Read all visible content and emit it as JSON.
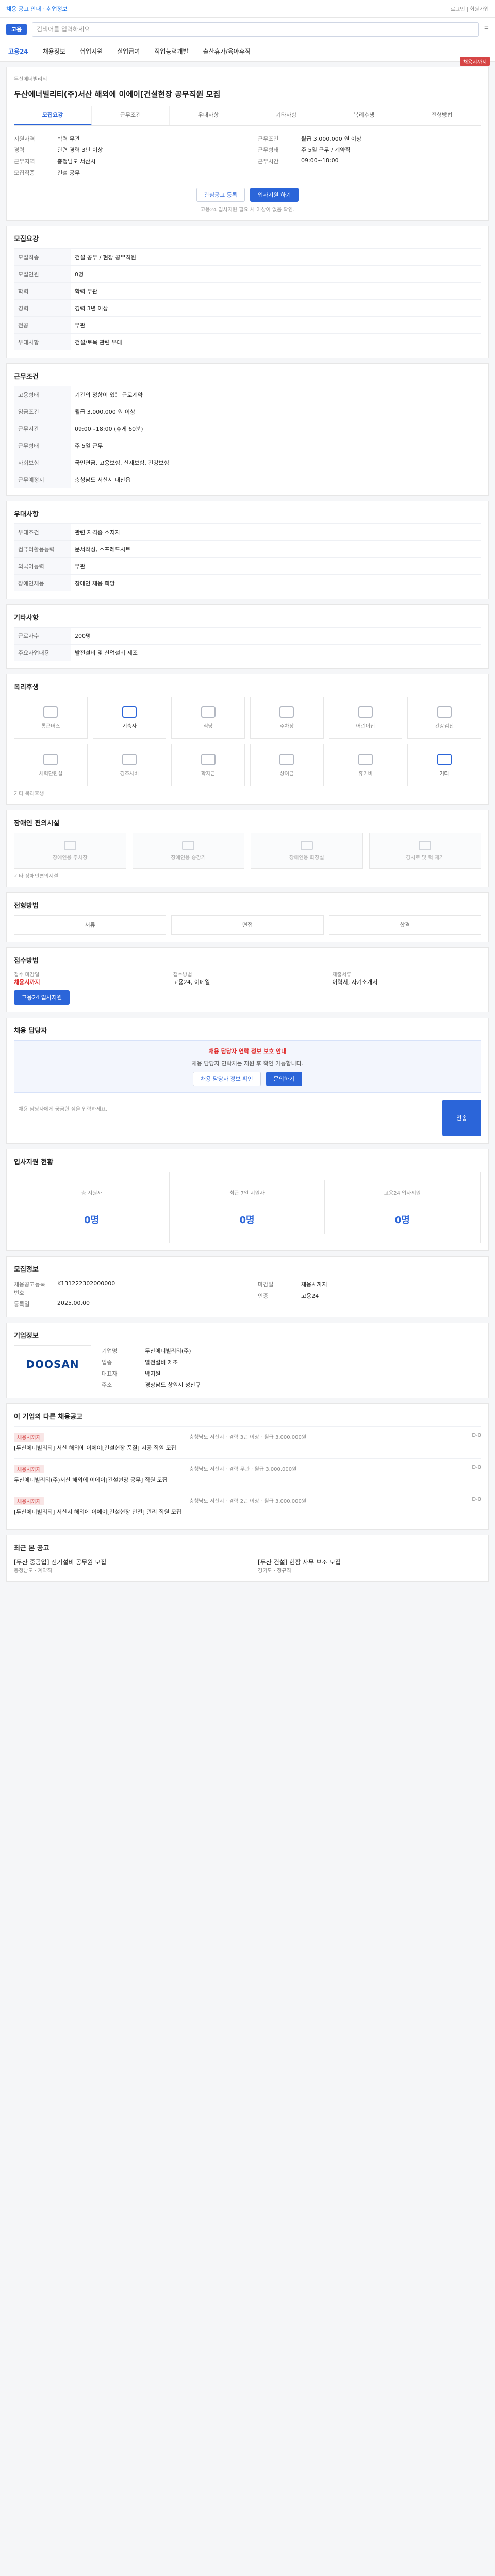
{
  "header": {
    "notice": "채용 공고 안내 · 취업정보",
    "search_placeholder": "검색어를 입력하세요",
    "nav": [
      "고용24",
      "채용정보",
      "취업지원",
      "실업급여",
      "직업능력개발",
      "출산휴가/육아휴직"
    ]
  },
  "job": {
    "company": "두산에너빌리티",
    "title": "두산에너빌리티(주)서산 해외에 이에이[건설현장 공무직원 모집",
    "right_badge": "채용시까지",
    "tabs": [
      "모집요강",
      "근무조건",
      "우대사항",
      "기타사항",
      "복리후생",
      "전형방법"
    ],
    "button_bookmark": "관심공고 등록",
    "button_apply": "입사지원 하기",
    "meta_notice": "고용24 입사지원 필요 시 이상이 없음 확인."
  },
  "summary": {
    "left": [
      {
        "k": "지원자격",
        "v": "학력 무관"
      },
      {
        "k": "경력",
        "v": "관련 경력 3년 이상"
      },
      {
        "k": "근무지역",
        "v": "충청남도 서산시"
      },
      {
        "k": "모집직종",
        "v": "건설 공무"
      }
    ],
    "right": [
      {
        "k": "근무조건",
        "v": "월급 3,000,000 원 이상"
      },
      {
        "k": "근무형태",
        "v": "주 5일 근무 / 계약직"
      },
      {
        "k": "근무시간",
        "v": "09:00~18:00"
      }
    ]
  },
  "recruit_table": [
    {
      "k": "모집직종",
      "v": "건설 공무 / 현장 공무직원"
    },
    {
      "k": "모집인원",
      "v": "0명"
    },
    {
      "k": "학력",
      "v": "학력 무관"
    },
    {
      "k": "경력",
      "v": "경력 3년 이상"
    },
    {
      "k": "전공",
      "v": "무관"
    },
    {
      "k": "우대사항",
      "v": "건설/토목 관련 우대"
    }
  ],
  "work_table": [
    {
      "k": "고용형태",
      "v": "기간의 정함이 있는 근로계약"
    },
    {
      "k": "임금조건",
      "v": "월급 3,000,000 원 이상"
    },
    {
      "k": "근무시간",
      "v": "09:00~18:00 (휴게 60분)"
    },
    {
      "k": "근무형태",
      "v": "주 5일 근무"
    },
    {
      "k": "사회보험",
      "v": "국민연금, 고용보험, 산재보험, 건강보험"
    },
    {
      "k": "근무예정지",
      "v": "충청남도 서산시 대산읍"
    }
  ],
  "pref_table": [
    {
      "k": "우대조건",
      "v": "관련 자격증 소지자"
    },
    {
      "k": "컴퓨터활용능력",
      "v": "문서작성, 스프레드시트"
    },
    {
      "k": "외국어능력",
      "v": "무관"
    },
    {
      "k": "장애인채용",
      "v": "장애인 채용 희망"
    }
  ],
  "other_table": [
    {
      "k": "근로자수",
      "v": "200명"
    },
    {
      "k": "주요사업내용",
      "v": "발전설비 및 산업설비 제조"
    }
  ],
  "welfare": {
    "title": "복리후생",
    "items": [
      {
        "icon": "bus-icon",
        "label": "통근버스",
        "on": false
      },
      {
        "icon": "car-icon",
        "label": "기숙사",
        "on": true
      },
      {
        "icon": "meal-icon",
        "label": "식당",
        "on": false
      },
      {
        "icon": "parking-icon",
        "label": "주차장",
        "on": false
      },
      {
        "icon": "child-icon",
        "label": "어린이집",
        "on": false
      },
      {
        "icon": "health-icon",
        "label": "건강검진",
        "on": false
      },
      {
        "icon": "gym-icon",
        "label": "체력단련실",
        "on": false
      },
      {
        "icon": "gift-icon",
        "label": "경조사비",
        "on": false
      },
      {
        "icon": "school-icon",
        "label": "학자금",
        "on": false
      },
      {
        "icon": "bonus-icon",
        "label": "상여금",
        "on": false
      },
      {
        "icon": "vacation-icon",
        "label": "휴가비",
        "on": false
      },
      {
        "icon": "other-icon",
        "label": "기타",
        "on": true
      }
    ],
    "note": "기타 복리후생"
  },
  "support": {
    "title": "장애인 편의시설",
    "items": [
      "장애인용 주차장",
      "장애인용 승강기",
      "장애인용 화장실",
      "경사로 및 턱 제거"
    ],
    "note": "기타 장애인편의시설"
  },
  "process": {
    "title": "전형방법",
    "steps": [
      "서류",
      "면접",
      "합격"
    ]
  },
  "method": {
    "title": "접수방법",
    "col1_title": "접수 마감일",
    "col1_value": "채용시까지",
    "col1_button": "고용24 입사지원",
    "col2_title": "접수방법",
    "col2_value": "고용24, 이메일",
    "col3_title": "제출서류",
    "col3_value": "이력서, 자기소개서"
  },
  "inquiry": {
    "title": "채용 담당자",
    "alert": "채용 담당자 연락 정보 보호 안내",
    "guide": "채용 담당자 연락처는 지원 후 확인 가능합니다.",
    "button1": "채용 담당자 정보 확인",
    "button2": "문의하기",
    "placeholder": "채용 담당자에게 궁금한 점을 입력하세요.",
    "send": "전송"
  },
  "stats": {
    "title": "입사지원 현황",
    "items": [
      {
        "label": "총 지원자",
        "value": "0명"
      },
      {
        "label": "최근 7일 지원자",
        "value": "0명"
      },
      {
        "label": "고용24 입사지원",
        "value": "0명"
      }
    ]
  },
  "rec_info": {
    "title": "모집정보",
    "left": [
      {
        "k": "채용공고등록번호",
        "v": "K131222302000000"
      },
      {
        "k": "등록일",
        "v": "2025.00.00"
      }
    ],
    "right": [
      {
        "k": "마감일",
        "v": "채용시까지"
      },
      {
        "k": "인증",
        "v": "고용24"
      }
    ]
  },
  "company": {
    "title": "기업정보",
    "logo_text": "DOOSAN",
    "fields": [
      {
        "k": "기업명",
        "v": "두산에너빌리티(주)"
      },
      {
        "k": "업종",
        "v": "발전설비 제조"
      },
      {
        "k": "대표자",
        "v": "박지원"
      },
      {
        "k": "주소",
        "v": "경상남도 창원시 성산구"
      }
    ]
  },
  "related": {
    "title": "이 기업의 다른 채용공고",
    "items": [
      {
        "badge": "채용시까지",
        "title": "[두산에너빌리티] 서산 해외에 이에이[건설현장 품질] 시공 직원 모집",
        "info": "충청남도 서산시 · 경력 3년 이상 · 월급 3,000,000원",
        "date": "D-0"
      },
      {
        "badge": "채용시까지",
        "title": "두산에너빌리티(주)서산 해외에 이에이[건설현장 공무] 직원 모집",
        "info": "충청남도 서산시 · 경력 무관 · 월급 3,000,000원",
        "date": "D-0"
      },
      {
        "badge": "채용시까지",
        "title": "[두산에너빌리티] 서산시 해외에 이에이[건설현장 안전] 관리 직원 모집",
        "info": "충청남도 서산시 · 경력 2년 이상 · 월급 3,000,000원",
        "date": "D-0"
      }
    ]
  },
  "footer": {
    "title": "최근 본 공고",
    "items": [
      {
        "name": "[두산 중공업] 전기설비 공무원 모집",
        "meta": "충청남도 · 계약직"
      },
      {
        "name": "[두산 건설] 현장 사무 보조 모집",
        "meta": "경기도 · 정규직"
      }
    ]
  }
}
